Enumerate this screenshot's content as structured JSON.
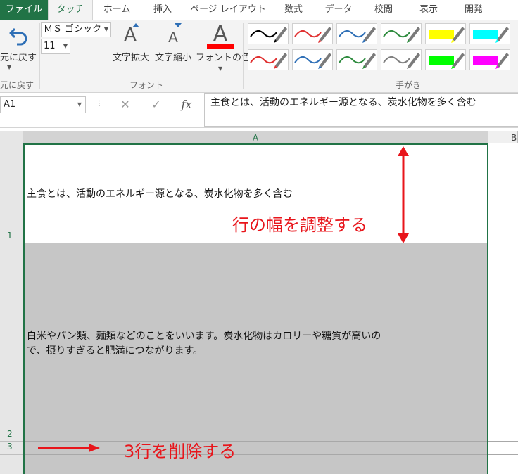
{
  "tabs": [
    "ファイル",
    "タッチ",
    "ホーム",
    "挿入",
    "ページ レイアウト",
    "数式",
    "データ",
    "校閲",
    "表示",
    "開発"
  ],
  "ribbon": {
    "undo_label": "元に戻す",
    "group_undo": "元に戻す",
    "font_name": "ＭＳ ゴシック",
    "font_size": "11",
    "grow_label": "文字拡大",
    "shrink_label": "文字縮小",
    "font_color_label": "フォントの色",
    "group_font": "フォント",
    "group_handwriting": "手がき",
    "grow_glyph": "A",
    "shrink_glyph": "A",
    "color_glyph": "A",
    "font_color": "#ff0000"
  },
  "pens": [
    {
      "color": "#000000",
      "type": "pen"
    },
    {
      "color": "#e03030",
      "type": "pen"
    },
    {
      "color": "#2e6fb6",
      "type": "pen"
    },
    {
      "color": "#2e8b3e",
      "type": "pen"
    },
    {
      "color": "#ffff00",
      "type": "highlighter"
    },
    {
      "color": "#00ffff",
      "type": "highlighter"
    },
    {
      "color": "#e03030",
      "type": "pen"
    },
    {
      "color": "#2e6fb6",
      "type": "pen"
    },
    {
      "color": "#2e8b3e",
      "type": "pen"
    },
    {
      "color": "#808080",
      "type": "pen"
    },
    {
      "color": "#00ff00",
      "type": "highlighter"
    },
    {
      "color": "#ff00ff",
      "type": "highlighter"
    }
  ],
  "formula_bar": {
    "name_box": "A1",
    "cancel": "✕",
    "enter": "✓",
    "fx": "fx",
    "content": "主食とは、活動のエネルギー源となる、炭水化物を多く含む"
  },
  "grid": {
    "col_a": "A",
    "col_b": "B",
    "rows": [
      "1",
      "2",
      "3"
    ],
    "a1": "主食とは、活動のエネルギー源となる、炭水化物を多く含む",
    "a2_line1": "白米やパン類、麺類などのことをいいます。炭水化物はカロリーや糖質が高いの",
    "a2_line2": "で、摂りすぎると肥満につながります。"
  },
  "annotations": {
    "row_height": "行の幅を調整する",
    "delete_row": "3行を削除する",
    "color": "#e8151b"
  }
}
